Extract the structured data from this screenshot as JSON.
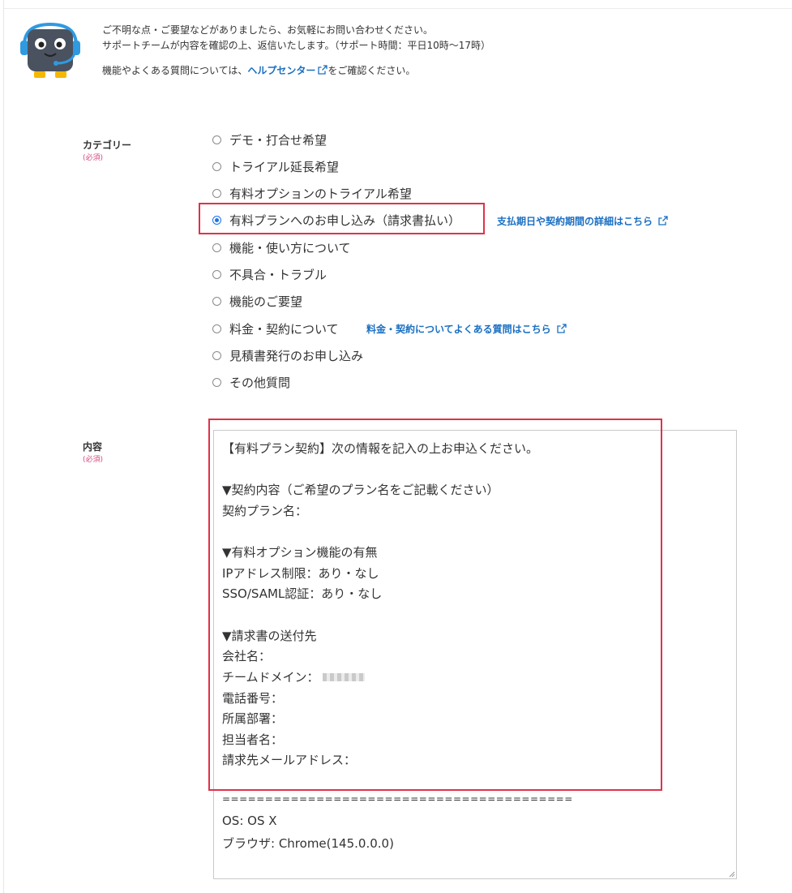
{
  "intro": {
    "line1": "ご不明な点・ご要望などがありましたら、お気軽にお問い合わせください。",
    "line2": "サポートチームが内容を確認の上、返信いたします。（サポート時間：平日10時〜17時）",
    "line3_prefix": "機能やよくある質問については、",
    "help_link": "ヘルプセンター",
    "line3_suffix": "をご確認ください。"
  },
  "category": {
    "label": "カテゴリー",
    "required": "(必須)",
    "options": [
      "デモ・打合せ希望",
      "トライアル延長希望",
      "有料オプションのトライアル希望",
      "有料プランへのお申し込み（請求書払い）",
      "機能・使い方について",
      "不具合・トラブル",
      "機能のご要望",
      "料金・契約について",
      "見積書発行のお申し込み",
      "その他質問"
    ],
    "selected_index": 3,
    "link_billing": "支払期日や契約期間の詳細はこちら",
    "link_pricing_faq": "料金・契約についてよくある質問はこちら"
  },
  "content": {
    "label": "内容",
    "required": "(必須)",
    "lines": [
      "【有料プラン契約】次の情報を記入の上お申込ください。",
      "▼契約内容（ご希望のプラン名をご記載ください）",
      "契約プラン名：",
      "▼有料オプション機能の有無",
      "IPアドレス制限：あり・なし",
      "SSO/SAML認証：あり・なし",
      "▼請求書の送付先",
      "会社名：",
      "チームドメイン：",
      "電話番号：",
      "所属部署：",
      "担当者名：",
      "請求先メールアドレス：",
      "=========================================",
      "OS: OS X",
      "ブラウザ: Chrome(145.0.0.0)"
    ]
  },
  "colors": {
    "link": "#1a6fc2",
    "highlight": "#e0324a",
    "required": "#d9467f",
    "radio_checked": "#1a73e8"
  }
}
